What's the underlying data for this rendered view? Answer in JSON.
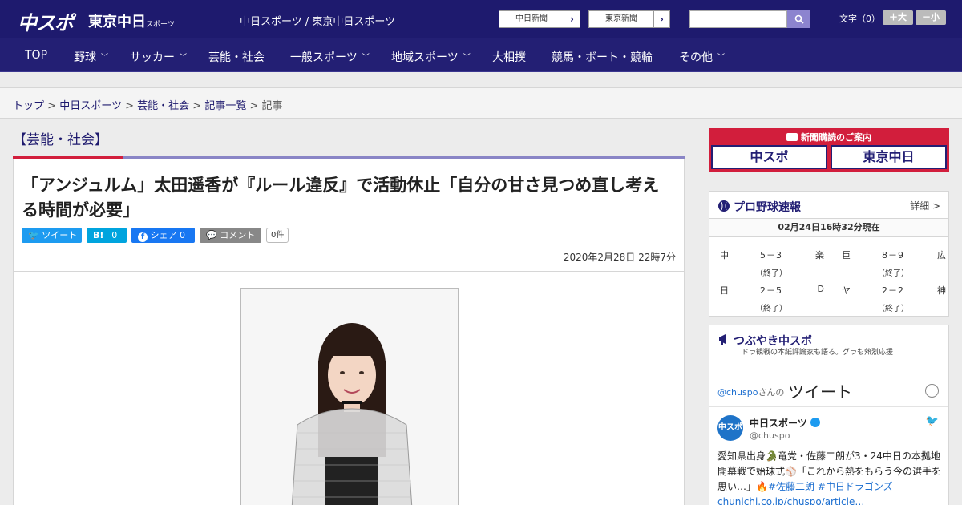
{
  "header": {
    "logo_chuspo": "中スポ",
    "logo_tokyo": "東京中日",
    "logo_tokyo_small": "スポーツ",
    "site_title": "中日スポーツ / 東京中日スポーツ",
    "ext_links": [
      "中日新聞",
      "東京新聞"
    ],
    "search_placeholder": "",
    "font_size_label": "文字（0）",
    "font_plus": "＋大",
    "font_minus": "－小"
  },
  "nav": {
    "items": [
      "TOP",
      "野球",
      "サッカー",
      "芸能・社会",
      "一般スポーツ",
      "地域スポーツ",
      "大相撲",
      "競馬・ボート・競輪",
      "その他"
    ]
  },
  "breadcrumb": {
    "items": [
      "トップ",
      "中日スポーツ",
      "芸能・社会",
      "記事一覧"
    ],
    "current": "記事",
    "sep": ">"
  },
  "article": {
    "category": "【芸能・社会】",
    "headline": "「アンジュルム」太田遥香が『ルール違反』で活動休止「自分の甘さ見つめ直し考える時間が必要」",
    "share": {
      "tweet": "ツイート",
      "hatena": "B!",
      "hatena_count": "0",
      "facebook": "シェア",
      "facebook_count": "0",
      "comment": "コメント",
      "comment_count": "0件"
    },
    "date": "2020年2月28日 22時7分"
  },
  "sidebar": {
    "subscribe": {
      "title": "新聞購読のご案内",
      "logos": [
        "中スポ",
        "東京中日"
      ]
    },
    "baseball": {
      "title": "プロ野球速報",
      "detail": "詳細 >",
      "time": "02月24日16時32分現在",
      "games": [
        {
          "home": "中",
          "score": "5－3",
          "away": "楽",
          "status": "（終了）"
        },
        {
          "home": "巨",
          "score": "8－9",
          "away": "広",
          "status": "（終了）"
        },
        {
          "home": "日",
          "score": "2－5",
          "away": "D",
          "status": "（終了）"
        },
        {
          "home": "ヤ",
          "score": "2－2",
          "away": "神",
          "status": "（終了）"
        }
      ]
    },
    "tweets": {
      "title": "つぶやき中スポ",
      "desc": "ドラ観戦の本紙評論家も語る。グラも熱烈応援",
      "handle_at": "@chuspo",
      "handle_suffix": "さんの",
      "header_big": "ツイート",
      "info": "i",
      "avatar": "中スポ",
      "name": "中日スポーツ",
      "user": "@chuspo",
      "body_1": "愛知県出身🐊竜党・佐藤二朗が3・24中日の本拠地開幕戦で始球式⚾「これから熱をもらう今の選手を思い…」🔥",
      "tag_1": "#佐藤二朗",
      "tag_2": "#中日ドラゴンズ",
      "link": "chunichi.co.jp/chuspo/article…"
    }
  }
}
